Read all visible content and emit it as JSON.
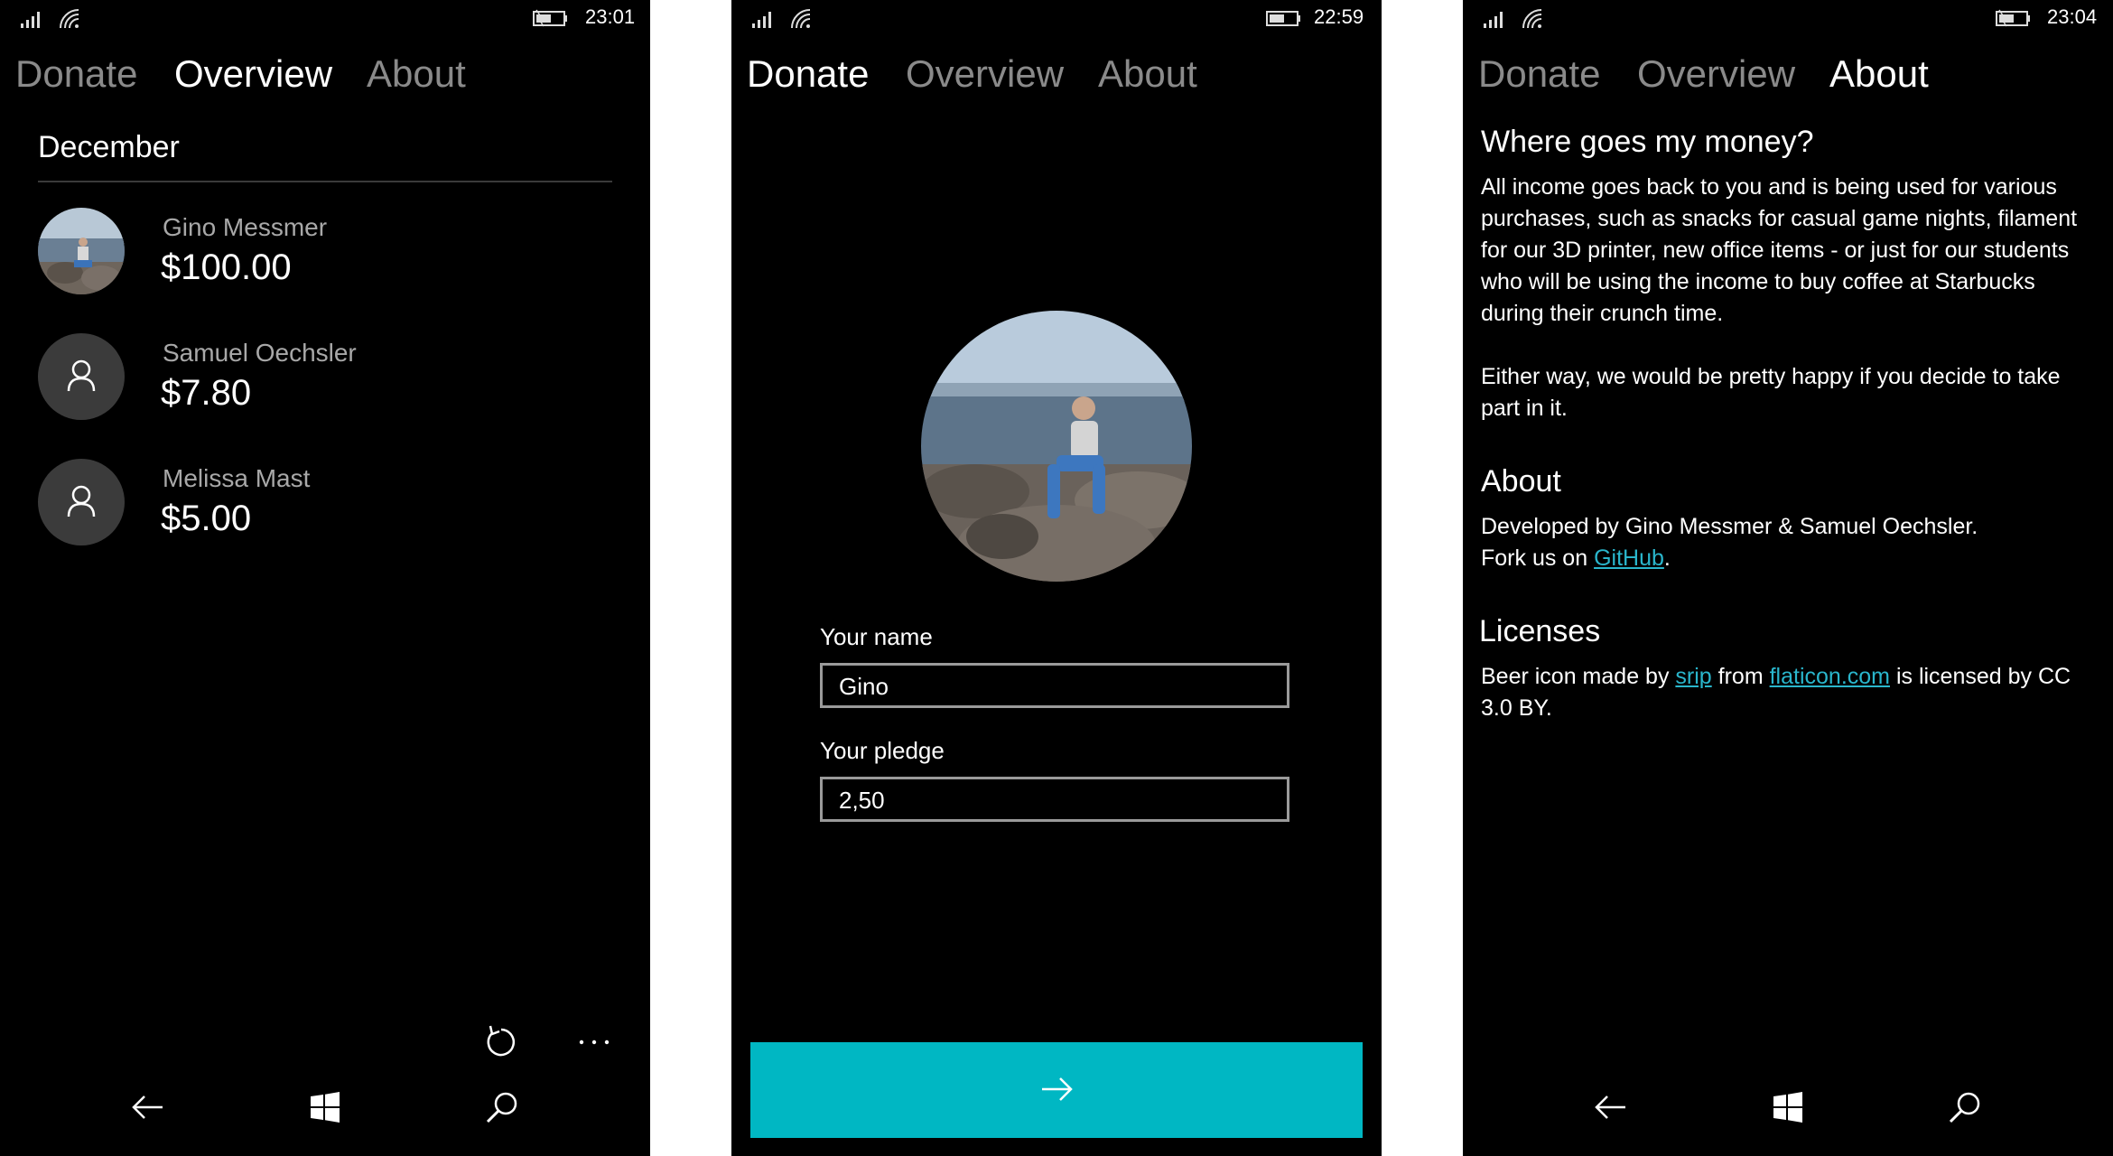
{
  "tabs": {
    "donate": "Donate",
    "overview": "Overview",
    "about": "About"
  },
  "screens": {
    "overview": {
      "time": "23:01",
      "month": "December",
      "donors": [
        {
          "name": "Gino Messmer",
          "amount": "$100.00",
          "avatar": "photo"
        },
        {
          "name": "Samuel Oechsler",
          "amount": "$7.80",
          "avatar": "person-icon"
        },
        {
          "name": "Melissa Mast",
          "amount": "$5.00",
          "avatar": "person-icon"
        }
      ],
      "appbar": [
        "refresh-icon",
        "more-icon"
      ]
    },
    "donate": {
      "time": "22:59",
      "name_label": "Your name",
      "name_value": "Gino",
      "pledge_label": "Your pledge",
      "pledge_value": "2,50",
      "submit_icon": "arrow-right-icon"
    },
    "about": {
      "time": "23:04",
      "money_heading": "Where goes my money?",
      "money_text_1": "All income goes back to you and is being used for various purchases, such as snacks for casual game nights, filament for our 3D printer, new office items - or just for our students who will be using the income to buy coffee at Starbucks during their crunch time.",
      "money_text_2": "Either way, we would be pretty happy if you decide to take part in it.",
      "about_heading": "About",
      "developed_by": "Developed by Gino Messmer & Samuel Oechsler.",
      "fork_prefix": "Fork us on ",
      "fork_link": "GitHub",
      "fork_suffix": ".",
      "licenses_heading": "Licenses",
      "license_prefix": "Beer icon made by ",
      "license_author": "srip",
      "license_mid": " from ",
      "license_site": "flaticon.com",
      "license_suffix": " is licensed by CC 3.0 BY."
    }
  },
  "navbar": [
    "back-icon",
    "windows-icon",
    "search-icon"
  ],
  "colors": {
    "accent": "#00b7c3",
    "link": "#2ab6cc",
    "inactive_tab": "#8a8a8a"
  }
}
